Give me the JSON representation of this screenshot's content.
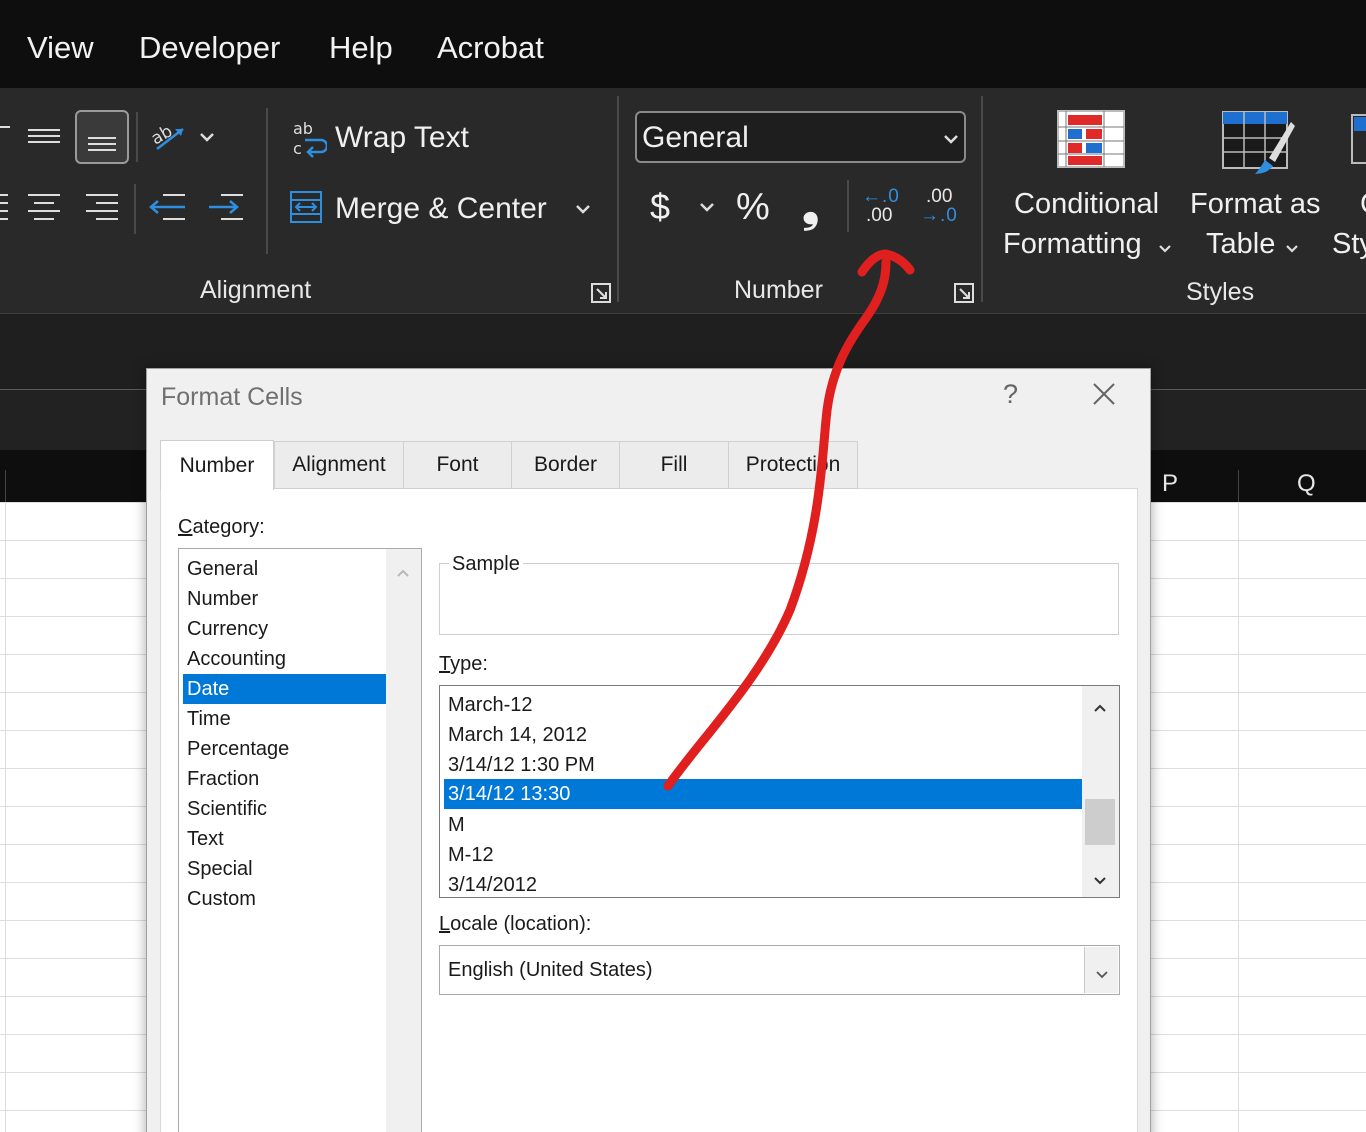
{
  "menu": {
    "items": [
      "View",
      "Developer",
      "Help",
      "Acrobat"
    ]
  },
  "ribbon": {
    "alignment": {
      "wrap_text": "Wrap Text",
      "merge_center": "Merge & Center",
      "group_label": "Alignment"
    },
    "number": {
      "format_value": "General",
      "currency_symbol": "$",
      "percent_symbol": "%",
      "comma_symbol": "❟",
      "increase_decimal_top": "←.0",
      "increase_decimal_bottom": ".00",
      "decrease_decimal_top": ".00",
      "decrease_decimal_bottom": "→.0",
      "group_label": "Number"
    },
    "styles": {
      "conditional_formatting_line1": "Conditional",
      "conditional_formatting_line2": "Formatting",
      "format_as_table_line1": "Format as",
      "format_as_table_line2": "Table",
      "cell_styles_line1": "C",
      "cell_styles_line2": "Sty",
      "group_label": "Styles"
    }
  },
  "column_headers": [
    "P",
    "Q"
  ],
  "dialog": {
    "title": "Format Cells",
    "help": "?",
    "tabs": [
      "Number",
      "Alignment",
      "Font",
      "Border",
      "Fill",
      "Protection"
    ],
    "active_tab": "Number",
    "category_label_first": "C",
    "category_label_rest": "ategory:",
    "categories": [
      "General",
      "Number",
      "Currency",
      "Accounting",
      "Date",
      "Time",
      "Percentage",
      "Fraction",
      "Scientific",
      "Text",
      "Special",
      "Custom"
    ],
    "selected_category": "Date",
    "sample_label": "Sample",
    "type_label_first": "T",
    "type_label_rest": "ype:",
    "types": [
      "March-12",
      "March 14, 2012",
      "3/14/12 1:30 PM",
      "3/14/12 13:30",
      "M",
      "M-12",
      "3/14/2012"
    ],
    "selected_type": "3/14/12 13:30",
    "locale_label_first": "L",
    "locale_label_rest": "ocale (location):",
    "locale_value": "English (United States)"
  },
  "colors": {
    "menu_bg": "#0e0e0e",
    "ribbon_bg": "#292929",
    "selection_blue": "#0078d7",
    "annotation_red": "#e01f1f",
    "accent_icon_blue": "#2f8fdf"
  },
  "annotation": {
    "type": "hand-drawn-arrow",
    "color": "#e01f1f",
    "from": "selected-date-type",
    "to": "increase-decimal-button"
  }
}
